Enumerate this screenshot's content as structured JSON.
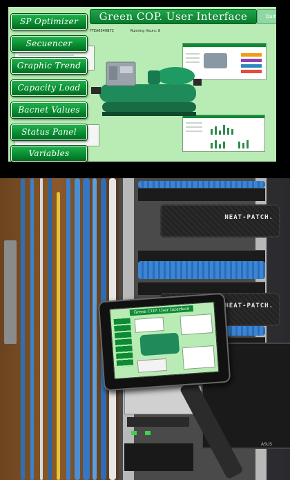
{
  "ui": {
    "title": "Green COP. User Interface",
    "quit_label": "Quit",
    "info": {
      "id_text": "FTEA6540B7C",
      "running_hours": "Running Hours: 8"
    },
    "menu": [
      "SP Optimizer",
      "Secuencer",
      "Graphic Trend",
      "Capacity Load",
      "Bacnet Values",
      "Status Panel",
      "Variables"
    ],
    "colors": {
      "screen_bg": "#b9ecb4",
      "menu_green": "#078a2f",
      "title_green": "#0b7a2e"
    }
  },
  "photo": {
    "neat_patch_label": "NEAT-PATCH.",
    "tablet_title": "Green COP. User Interface",
    "monitor_brand": "ASUS"
  }
}
